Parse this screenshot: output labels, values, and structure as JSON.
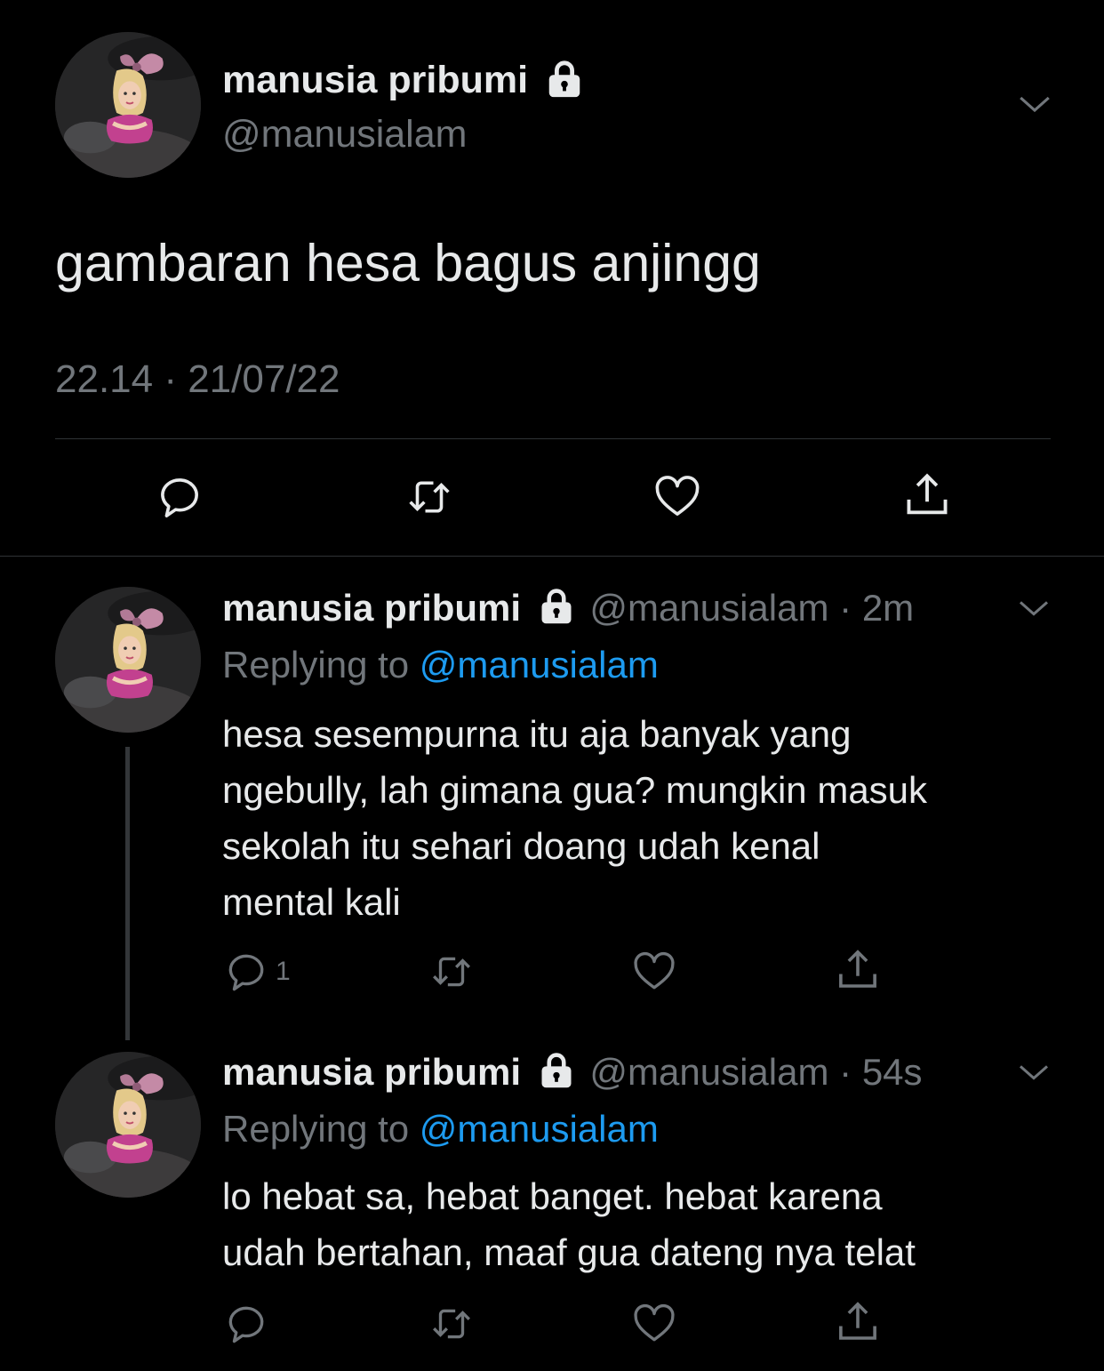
{
  "main_tweet": {
    "display_name": "manusia pribumi",
    "handle": "@manusialam",
    "text": "gambaran hesa bagus anjingg",
    "timestamp": "22.14 · 21/07/22",
    "actions": [
      "reply-icon",
      "retweet-icon",
      "like-icon",
      "share-icon"
    ]
  },
  "replies": [
    {
      "display_name": "manusia pribumi",
      "handle": "@manusialam",
      "time_sep": "·",
      "time": "2m",
      "replying_label": "Replying to",
      "replying_to": "@manusialam",
      "lines": [
        "hesa sesempurna itu aja banyak yang",
        "ngebully, lah gimana gua? mungkin masuk",
        "sekolah itu sehari doang udah kenal",
        "mental kali"
      ],
      "reply_count": "1"
    },
    {
      "display_name": "manusia pribumi",
      "handle": "@manusialam",
      "time_sep": "·",
      "time": "54s",
      "replying_label": "Replying to",
      "replying_to": "@manusialam",
      "lines": [
        "lo hebat sa, hebat banget. hebat karena",
        "udah bertahan, maaf gua dateng nya telat"
      ],
      "reply_count": ""
    }
  ],
  "colors": {
    "background": "#000000",
    "text": "#e7e9ea",
    "secondary": "#71767b",
    "link": "#1d9bf0",
    "divider": "#2f3336"
  }
}
